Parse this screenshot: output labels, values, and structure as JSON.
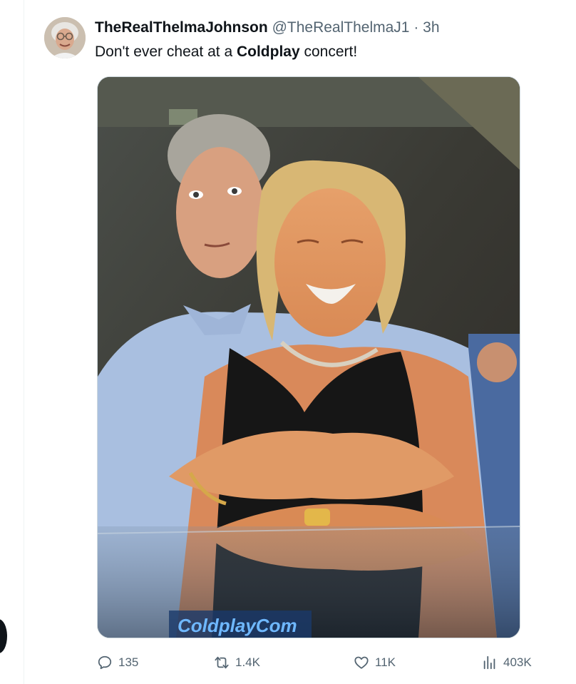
{
  "tweet": {
    "display_name": "TheRealThelmaJohnson",
    "handle": "@TheRealThelmaJ1",
    "separator": "·",
    "time": "3h",
    "text_before": "Don't ever cheat at a ",
    "text_bold": "Coldplay",
    "text_after": " concert!"
  },
  "media": {
    "banner_text": "ColdplayCom"
  },
  "actions": {
    "replies": "135",
    "retweets": "1.4K",
    "likes": "11K",
    "views": "403K"
  },
  "colors": {
    "secondary_text": "#536471",
    "primary_text": "#0f1419",
    "border": "#cfd9de"
  },
  "icons": [
    "avatar",
    "reply-icon",
    "retweet-icon",
    "like-icon",
    "views-icon"
  ]
}
